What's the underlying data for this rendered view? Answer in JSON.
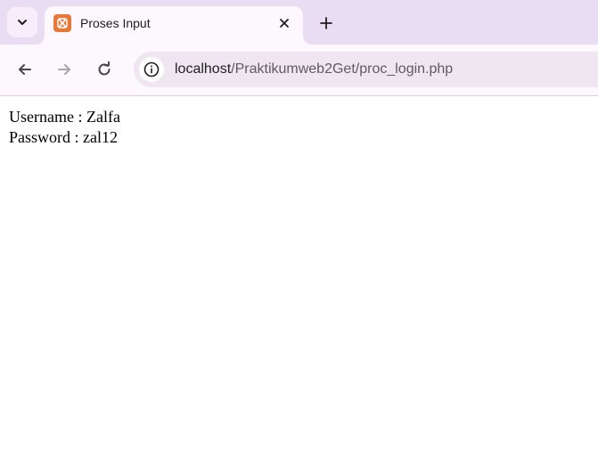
{
  "tab": {
    "title": "Proses Input",
    "favicon": "xampp-icon"
  },
  "toolbar": {
    "url_host": "localhost",
    "url_path": "/Praktikumweb2Get/proc_login.php"
  },
  "page": {
    "username_line": "Username : Zalfa",
    "password_line": "Password : zal12"
  },
  "colors": {
    "tabstrip": "#e9ddf3",
    "active_tab": "#fdf7fe",
    "omnibox": "#efe6f2",
    "favicon": "#e8783a"
  }
}
